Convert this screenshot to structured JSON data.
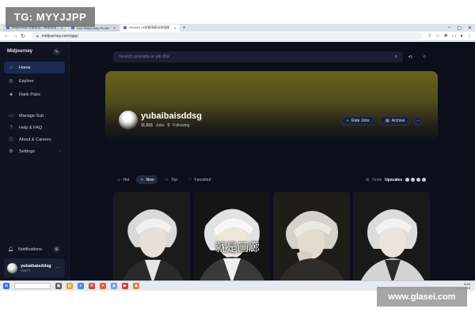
{
  "watermarks": {
    "top_left": "TG: MYYJJPP",
    "bottom_right": "www.glasei.com"
  },
  "browser": {
    "tabs": [
      {
        "label": "Midjourney 完整教程 - 新版动态",
        "active": false
      },
      {
        "label": "Your Midjourney Profile",
        "active": false
      },
      {
        "label": "Discord | #创意画廊动态画廊",
        "active": true
      }
    ],
    "url": "midjourney.com/app/",
    "url_icon": "lock-icon"
  },
  "app": {
    "brand": "Midjourney",
    "sidebar": {
      "items": [
        {
          "label": "Home",
          "icon": "home-icon",
          "active": true
        },
        {
          "label": "Explore",
          "icon": "compass-icon",
          "active": false
        },
        {
          "label": "Rank Pairs",
          "icon": "rank-icon",
          "active": false
        },
        {
          "label": "Manage Sub",
          "icon": "card-icon",
          "active": false
        },
        {
          "label": "Help & FAQ",
          "icon": "help-icon",
          "active": false
        },
        {
          "label": "About & Careers",
          "icon": "info-icon",
          "active": false
        },
        {
          "label": "Settings",
          "icon": "gear-icon",
          "active": false
        }
      ],
      "notifications_label": "Notifications",
      "user": {
        "name": "yubaibaisddsg",
        "tag": "#8677"
      }
    },
    "search": {
      "placeholder": "Search prompts or job IDs"
    },
    "profile": {
      "name": "yubaibaisddsg",
      "jobs_count": "11,016",
      "jobs_label": "Jobs",
      "following_count": "0",
      "following_label": "Following",
      "rate_button": "Rate Jobs",
      "archive_button": "Archive"
    },
    "feed_tabs": [
      {
        "label": "Hot",
        "icon": "fire-icon",
        "active": false
      },
      {
        "label": "New",
        "icon": "sparkle-icon",
        "active": true
      },
      {
        "label": "Top",
        "icon": "star-icon",
        "active": false
      },
      {
        "label": "Favorited",
        "icon": "heart-icon",
        "active": false
      }
    ],
    "grid_control": {
      "label": "Grids",
      "value": "Upscales"
    }
  },
  "subtitle": "就是画廊",
  "taskbar": {
    "time": "8:40",
    "date": "2023/4/13"
  }
}
